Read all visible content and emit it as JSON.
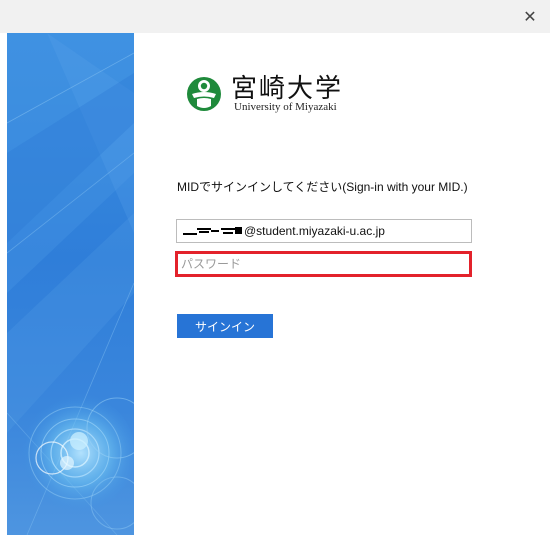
{
  "window": {
    "close_glyph": "✕"
  },
  "logo": {
    "name_ja": "宮崎大学",
    "name_en": "University of Miyazaki",
    "mark_icon": "miyazaki-university-emblem",
    "mark_color": "#1f8a3b"
  },
  "form": {
    "instruction": "MIDでサインインしてください(Sign-in with your MID.)",
    "username_suffix": "@student.miyazaki-u.ac.jp",
    "password_placeholder": "パスワード",
    "signin_label": "サインイン"
  },
  "colors": {
    "accent": "#2774d6",
    "highlight_border": "#e3222b",
    "side_panel": "#2f7ed9"
  }
}
